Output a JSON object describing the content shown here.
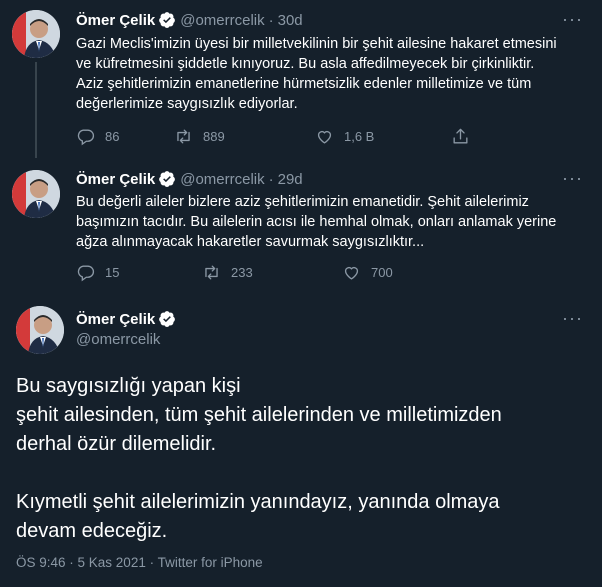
{
  "colors": {
    "background": "#15202b",
    "text": "#ffffff",
    "muted": "#8b98a5",
    "verified": "#1d9bf0",
    "line": "#38444d"
  },
  "tweets": [
    {
      "name": "Ömer Çelik",
      "handle": "@omerrcelik",
      "separator": "·",
      "time": "30d",
      "lines": [
        "Gazi Meclis'imizin üyesi bir milletvekilinin bir şehit ailesine hakaret etmesini",
        "ve küfretmesini şiddetle kınıyoruz. Bu asla affedilmeyecek bir çirkinliktir.",
        "Aziz şehitlerimizin emanetlerine hürmetsizlik edenler milletimize ve tüm",
        "değerlerimize saygısızlık ediyorlar."
      ],
      "replies": "86",
      "retweets": "889",
      "likes": "1,6 B",
      "icons": [
        "reply-icon",
        "retweet-icon",
        "like-icon",
        "share-icon"
      ]
    },
    {
      "name": "Ömer Çelik",
      "handle": "@omerrcelik",
      "separator": "·",
      "time": "29d",
      "lines": [
        "Bu değerli aileler bizlere aziz şehitlerimizin emanetidir. Şehit ailelerimiz",
        "başımızın tacıdır. Bu ailelerin acısı ile hemhal olmak, onları anlamak yerine",
        "ağza alınmayacak hakaretler savurmak saygısızlıktır..."
      ],
      "replies": "15",
      "retweets": "233",
      "likes": "700",
      "icons": [
        "reply-icon",
        "retweet-icon",
        "like-icon"
      ]
    }
  ],
  "main": {
    "name": "Ömer Çelik",
    "handle": "@omerrcelik",
    "lines": [
      "Bu saygısızlığı yapan kişi",
      "şehit ailesinden, tüm şehit ailelerinden ve milletimizden",
      "derhal özür dilemelidir.",
      "",
      "Kıymetli şehit ailelerimizin yanındayız, yanında olmaya",
      "devam edeceğiz."
    ],
    "meta": "ÖS 9:46 · 5 Kas 2021 · Twitter for iPhone"
  }
}
